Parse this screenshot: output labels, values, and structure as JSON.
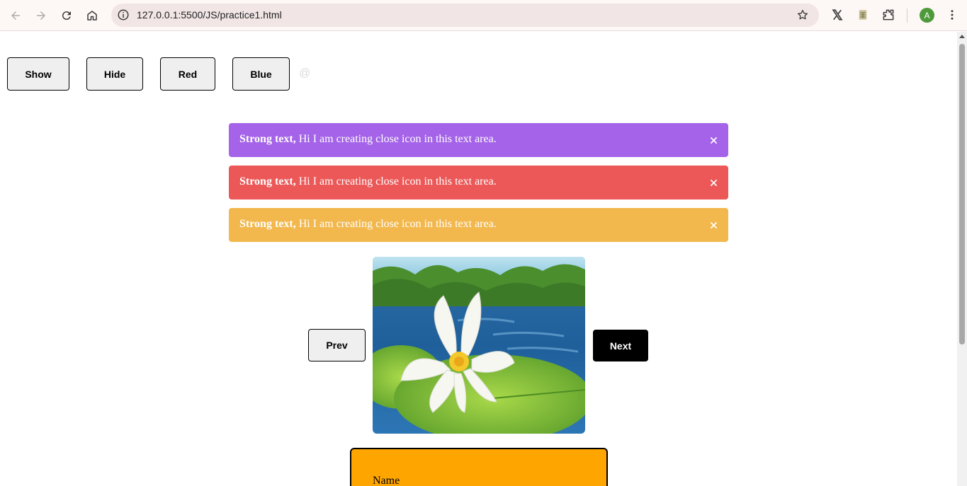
{
  "browser": {
    "url": "127.0.0.1:5500/JS/practice1.html",
    "avatar_letter": "A",
    "icons": [
      "back-icon",
      "forward-icon",
      "reload-icon",
      "home-icon",
      "site-info-icon",
      "bookmark-star-icon",
      "x-extension-icon",
      "sheets-extension-icon",
      "extensions-puzzle-icon",
      "menu-kebab-icon"
    ]
  },
  "controls": {
    "show_label": "Show",
    "hide_label": "Hide",
    "red_label": "Red",
    "blue_label": "Blue",
    "at_symbol": "@"
  },
  "alerts": [
    {
      "strong": "Strong text,",
      "text": " Hi I am creating close icon in this text area.",
      "color": "#a463e8",
      "close": "×"
    },
    {
      "strong": "Strong text,",
      "text": " Hi I am creating close icon in this text area.",
      "color": "#ec5858",
      "close": "×"
    },
    {
      "strong": "Strong text,",
      "text": " Hi I am creating close icon in this text area.",
      "color": "#f2b84d",
      "close": "×"
    }
  ],
  "slider": {
    "prev_label": "Prev",
    "next_label": "Next",
    "image": "water-lily-on-lily-pad-in-pond"
  },
  "form": {
    "name_label": "Name",
    "background": "#ffa500"
  }
}
